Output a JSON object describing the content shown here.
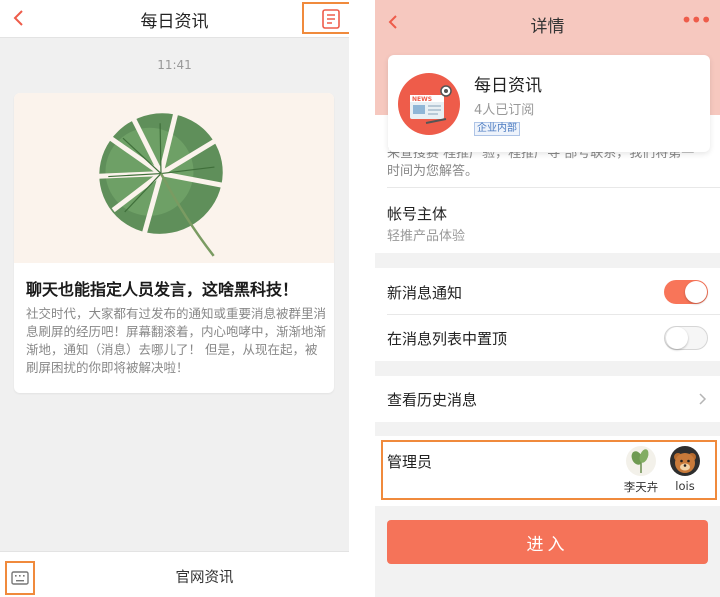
{
  "left": {
    "title": "每日资讯",
    "time": "11:41",
    "article": {
      "title": "聊天也能指定人员发言，这啥黑科技！",
      "body": "社交时代，大家都有过发布的通知或重要消息被群里消息刷屏的经历吧！屏幕翻滚着，内心咆哮中，渐渐地渐渐地，通知（消息）去哪儿了！ 但是，从现在起，被刷屏困扰的你即将被解决啦！"
    },
    "bottom_menu": "官网资讯"
  },
  "right": {
    "title": "详情",
    "more": "•••",
    "profile": {
      "name": "每日资讯",
      "subscribers": "4人已订阅",
      "tag": "企业内部",
      "logo_text": "NEWS"
    },
    "intro_partial": "来查搜赛 程推产验，程推产寻 部号联系，我们将第一时间为您解答。",
    "account": {
      "label": "帐号主体",
      "value": "轻推产品体验"
    },
    "settings": [
      {
        "label": "新消息通知",
        "on": true
      },
      {
        "label": "在消息列表中置顶",
        "on": false
      }
    ],
    "history": "查看历史消息",
    "admins": {
      "label": "管理员",
      "members": [
        {
          "name": "李天卉",
          "avatar": "plant-avatar"
        },
        {
          "name": "lois",
          "avatar": "bear-avatar"
        }
      ]
    },
    "enter": "进入"
  },
  "colors": {
    "accent": "#f57359",
    "header_bg": "#f6c8bf",
    "highlight": "#f08a3c",
    "tag_blue": "#4a7ac0"
  }
}
